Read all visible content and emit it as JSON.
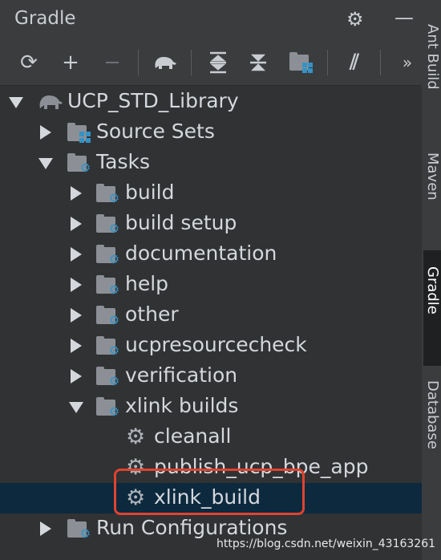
{
  "panel": {
    "title": "Gradle",
    "settings_icon": "gear-icon",
    "collapse_icon": "minus-icon"
  },
  "toolbar": {
    "buttons": [
      {
        "name": "refresh-icon",
        "glyph": "⟳"
      },
      {
        "name": "add-icon",
        "glyph": "+"
      },
      {
        "name": "remove-icon",
        "glyph": "−"
      },
      {
        "name": "elephant-icon",
        "glyph": ""
      },
      {
        "name": "expand-all-icon",
        "glyph": "⇕"
      },
      {
        "name": "collapse-all-icon",
        "glyph": "⇳"
      },
      {
        "name": "module-icon",
        "glyph": ""
      },
      {
        "name": "offline-icon",
        "glyph": "⫽"
      },
      {
        "name": "more-icon",
        "glyph": "»"
      }
    ]
  },
  "tree": {
    "root": "UCP_STD_Library",
    "source_sets": "Source Sets",
    "tasks": "Tasks",
    "groups": [
      "build",
      "build setup",
      "documentation",
      "help",
      "other",
      "ucpresourcecheck",
      "verification",
      "xlink builds"
    ],
    "xlink_tasks": [
      "cleanall",
      "publish_ucp_bpe_app",
      "xlink_build"
    ],
    "run_configurations": "Run Configurations"
  },
  "side_tabs": [
    "Ant Build",
    "Maven",
    "Gradle",
    "Database"
  ],
  "watermark": "https://blog.csdn.net/weixin_43163261",
  "colors": {
    "background": "#303234",
    "selection": "#0d293e",
    "accent": "#3592c4",
    "highlight_box": "#e0432f"
  }
}
